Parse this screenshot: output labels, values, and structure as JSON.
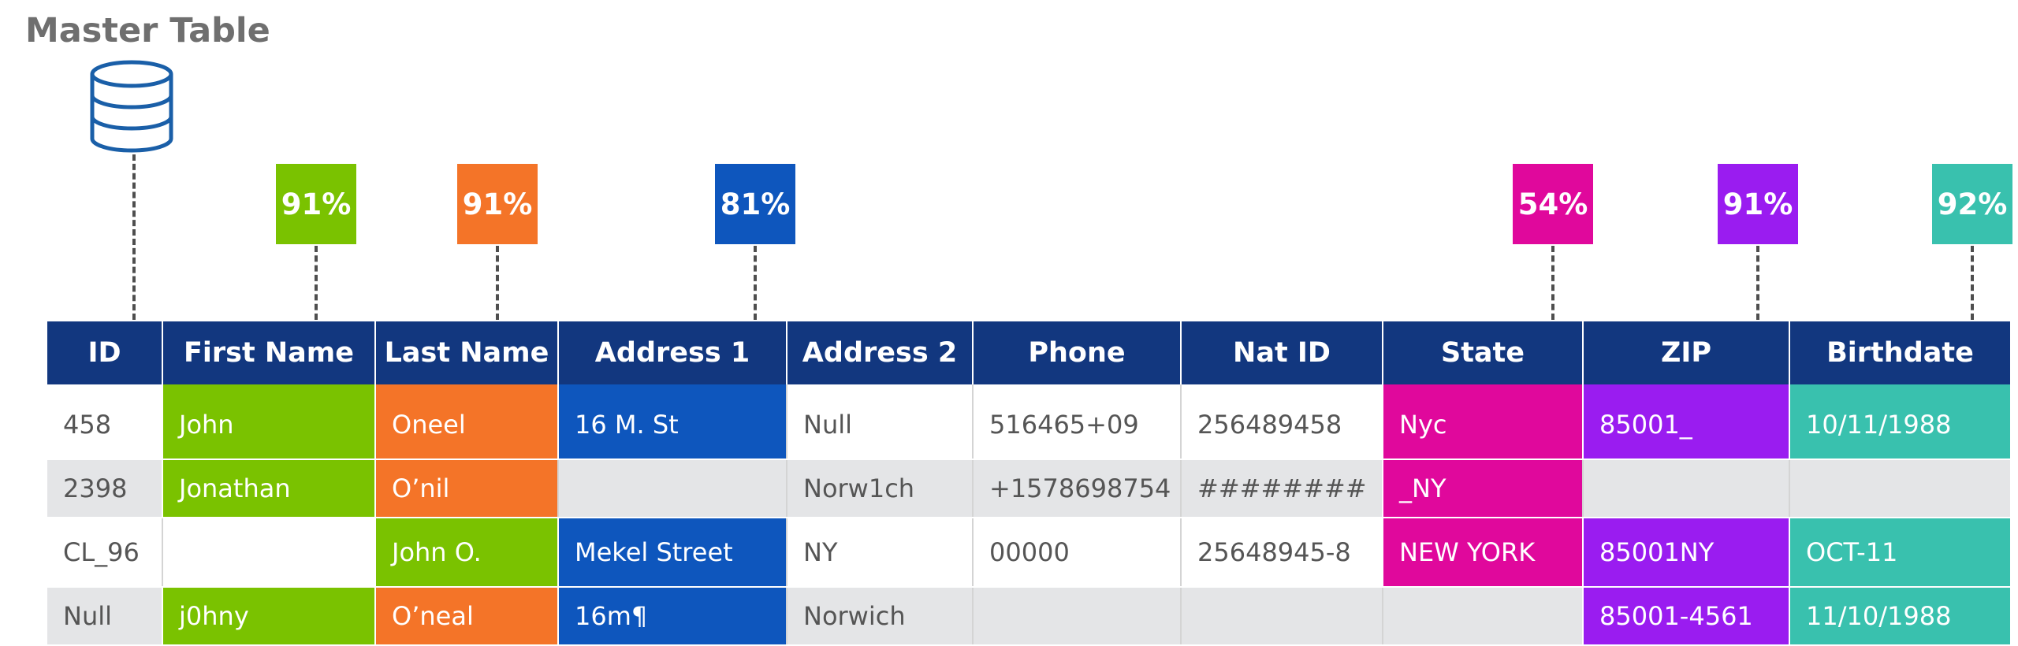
{
  "title": "Master Table",
  "colors": {
    "header_bg": "#12377f",
    "green": "#7ac200",
    "orange": "#f47428",
    "blue": "#0e56bd",
    "magenta": "#e0089c",
    "purple": "#9a1cf0",
    "teal": "#39c1ae",
    "row_shade": "#e4e5e7",
    "text_gray": "#555555"
  },
  "database_icon": "database-icon",
  "headers": [
    "ID",
    "First Name",
    "Last Name",
    "Address 1",
    "Address 2",
    "Phone",
    "Nat ID",
    "State",
    "ZIP",
    "Birthdate"
  ],
  "badges": [
    {
      "column": "First Name",
      "value": "91%",
      "color": "#7ac200"
    },
    {
      "column": "Last Name",
      "value": "91%",
      "color": "#f47428"
    },
    {
      "column": "Address 1",
      "value": "81%",
      "color": "#0e56bd"
    },
    {
      "column": "State",
      "value": "54%",
      "color": "#e0089c"
    },
    {
      "column": "ZIP",
      "value": "91%",
      "color": "#9a1cf0"
    },
    {
      "column": "Birthdate",
      "value": "92%",
      "color": "#39c1ae"
    }
  ],
  "rows": [
    [
      "458",
      "John",
      "Oneel",
      "16 M. St",
      "Null",
      "516465+09",
      "256489458",
      "Nyc",
      "85001_",
      "10/11/1988"
    ],
    [
      "2398",
      "Jonathan",
      "O’nil",
      "",
      "Norw1ch",
      "+1578698754",
      "########",
      "_NY",
      "",
      ""
    ],
    [
      "CL_96",
      "",
      "John O.",
      "Mekel Street",
      "NY",
      "00000",
      "25648945-8",
      "NEW YORK",
      "85001NY",
      "OCT-11"
    ],
    [
      "Null",
      "j0hny",
      "O’neal",
      "16m¶",
      "Norwich",
      "",
      "",
      "",
      "85001-4561",
      "11/10/1988"
    ]
  ],
  "highlights": [
    [
      null,
      "#7ac200",
      "#f47428",
      "#0e56bd",
      null,
      null,
      null,
      "#e0089c",
      "#9a1cf0",
      "#39c1ae"
    ],
    [
      null,
      "#7ac200",
      "#f47428",
      null,
      null,
      null,
      null,
      "#e0089c",
      null,
      null
    ],
    [
      null,
      null,
      "#7ac200",
      "#0e56bd",
      null,
      null,
      null,
      "#e0089c",
      "#9a1cf0",
      "#39c1ae"
    ],
    [
      null,
      "#7ac200",
      "#f47428",
      "#0e56bd",
      null,
      null,
      null,
      null,
      "#9a1cf0",
      "#39c1ae"
    ]
  ]
}
